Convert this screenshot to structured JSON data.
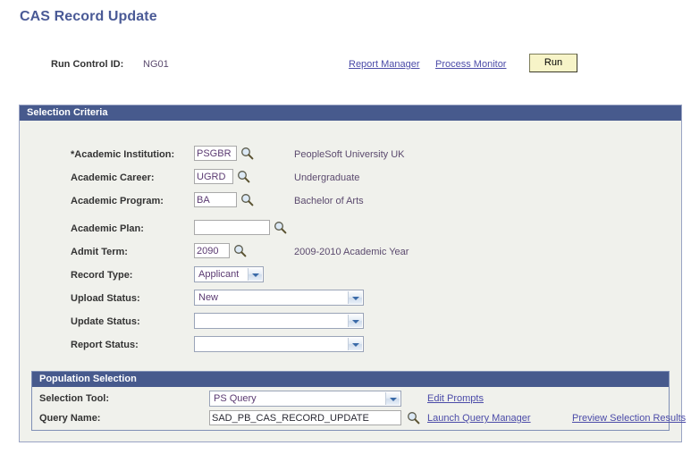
{
  "page": {
    "title": "CAS Record Update"
  },
  "run_control": {
    "label": "Run Control ID:",
    "value": "NG01",
    "report_manager_link": "Report Manager",
    "process_monitor_link": "Process Monitor",
    "run_button": "Run"
  },
  "selection_criteria": {
    "header": "Selection Criteria",
    "fields": [
      {
        "label": "*Academic Institution:",
        "type": "text",
        "value": "PSGBR",
        "width": 48,
        "has_lookup": true,
        "description": "PeopleSoft University UK"
      },
      {
        "label": "Academic Career:",
        "type": "text",
        "value": "UGRD",
        "width": 44,
        "has_lookup": true,
        "description": "Undergraduate"
      },
      {
        "label": "Academic Program:",
        "type": "text",
        "value": "BA",
        "width": 48,
        "has_lookup": true,
        "description": "Bachelor of  Arts"
      },
      {
        "label": "Academic Plan:",
        "type": "text",
        "value": "",
        "width": 85,
        "has_lookup": true,
        "description": ""
      },
      {
        "label": "Admit Term:",
        "type": "text",
        "value": "2090",
        "width": 40,
        "has_lookup": true,
        "description": "2009-2010 Academic Year"
      },
      {
        "label": "Record Type:",
        "type": "select",
        "value": "Applicant",
        "width": 78,
        "has_lookup": false,
        "description": ""
      },
      {
        "label": "Upload Status:",
        "type": "select",
        "value": "New",
        "width": 190,
        "has_lookup": false,
        "description": ""
      },
      {
        "label": "Update Status:",
        "type": "select",
        "value": "",
        "width": 190,
        "has_lookup": false,
        "description": ""
      },
      {
        "label": "Report Status:",
        "type": "select",
        "value": "",
        "width": 190,
        "has_lookup": false,
        "description": ""
      }
    ]
  },
  "population_selection": {
    "header": "Population Selection",
    "selection_tool_label": "Selection Tool:",
    "selection_tool_value": "PS Query",
    "query_name_label": "Query Name:",
    "query_name_value": "SAD_PB_CAS_RECORD_UPDATE",
    "edit_prompts_link": "Edit Prompts",
    "launch_query_manager_link": "Launch Query Manager",
    "preview_selection_results_link": "Preview Selection Results"
  },
  "colors": {
    "title": "#4a5a96",
    "header_bar": "#475a8d",
    "panel_bg": "#f0f1ec",
    "link": "#4b4ba8",
    "field_value": "#5b3a72",
    "run_button": "#f7f4c8"
  },
  "icons": {
    "lookup": "magnifier-icon",
    "dropdown": "chevron-down-icon"
  }
}
